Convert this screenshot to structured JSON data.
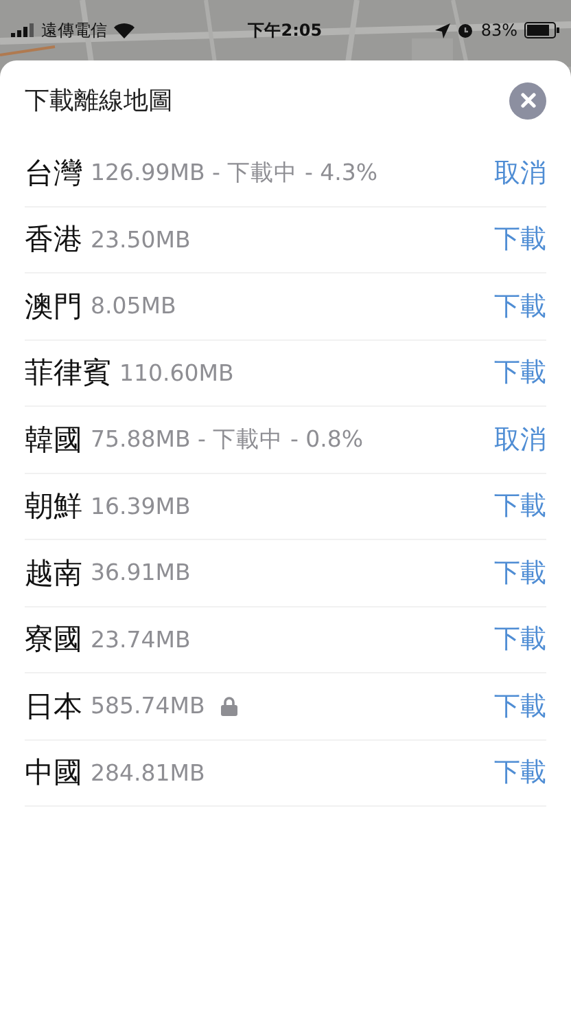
{
  "status_bar": {
    "carrier": "遠傳電信",
    "time": "下午2:05",
    "battery": "83%"
  },
  "sheet": {
    "title": "下載離線地圖"
  },
  "regions": [
    {
      "name": "台灣",
      "detail": "126.99MB - 下載中 - 4.3%",
      "action": "取消",
      "locked": false
    },
    {
      "name": "香港",
      "detail": "23.50MB",
      "action": "下載",
      "locked": false
    },
    {
      "name": "澳門",
      "detail": "8.05MB",
      "action": "下載",
      "locked": false
    },
    {
      "name": "菲律賓",
      "detail": "110.60MB",
      "action": "下載",
      "locked": false
    },
    {
      "name": "韓國",
      "detail": "75.88MB - 下載中 - 0.8%",
      "action": "取消",
      "locked": false
    },
    {
      "name": "朝鮮",
      "detail": "16.39MB",
      "action": "下載",
      "locked": false
    },
    {
      "name": "越南",
      "detail": "36.91MB",
      "action": "下載",
      "locked": false
    },
    {
      "name": "寮國",
      "detail": "23.74MB",
      "action": "下載",
      "locked": false
    },
    {
      "name": "日本",
      "detail": "585.74MB",
      "action": "下載",
      "locked": true
    },
    {
      "name": "中國",
      "detail": "284.81MB",
      "action": "下載",
      "locked": false
    }
  ]
}
